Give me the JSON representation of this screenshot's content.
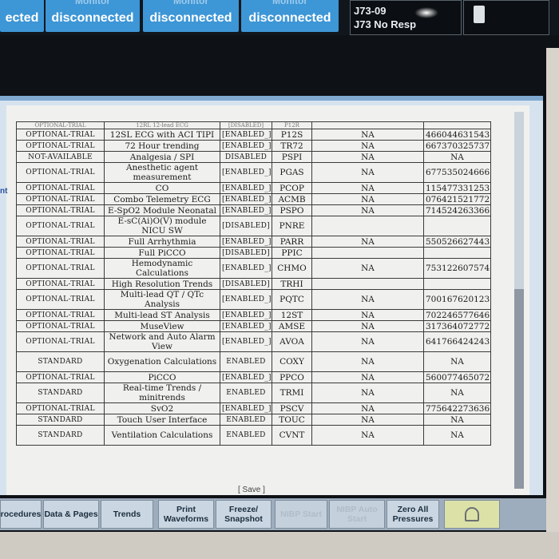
{
  "top_bar": {
    "tiles": [
      {
        "label": "ected",
        "ghost": ""
      },
      {
        "label": "disconnected",
        "ghost": "Monitor"
      },
      {
        "label": "disconnected",
        "ghost": "Monitor"
      },
      {
        "label": "disconnected",
        "ghost": "Monitor"
      }
    ],
    "alarm": {
      "line1": "J73-09",
      "line2": "J73 No Resp"
    }
  },
  "side_fragment": "nt",
  "table": {
    "partial_top": {
      "status": "OPTIONAL-TRIAL",
      "feature": "12RL 12-lead ECG",
      "enabled": "[DISABLED]",
      "code": "P12R"
    },
    "rows": [
      {
        "status": "OPTIONAL-TRIAL",
        "feature": "12SL ECG with ACI TIPI",
        "enabled": "[ENABLED_]",
        "code": "P12S",
        "na": "NA",
        "serial": "466044631543"
      },
      {
        "status": "OPTIONAL-TRIAL",
        "feature": "72 Hour trending",
        "enabled": "[ENABLED_]",
        "code": "TR72",
        "na": "NA",
        "serial": "667370325737"
      },
      {
        "status": "NOT-AVAILABLE",
        "feature": "Analgesia / SPI",
        "enabled": "DISABLED",
        "code": "PSPI",
        "na": "NA",
        "serial": "NA"
      },
      {
        "status": "OPTIONAL-TRIAL",
        "feature": "Anesthetic agent measurement",
        "enabled": "[ENABLED_]",
        "code": "PGAS",
        "na": "NA",
        "serial": "677535024666"
      },
      {
        "status": "OPTIONAL-TRIAL",
        "feature": "CO",
        "enabled": "[ENABLED_]",
        "code": "PCOP",
        "na": "NA",
        "serial": "115477331253"
      },
      {
        "status": "OPTIONAL-TRIAL",
        "feature": "Combo Telemetry ECG",
        "enabled": "[ENABLED_]",
        "code": "ACMB",
        "na": "NA",
        "serial": "076421521772"
      },
      {
        "status": "OPTIONAL-TRIAL",
        "feature": "E-SpO2 Module Neonatal",
        "enabled": "[ENABLED_]",
        "code": "PSPO",
        "na": "NA",
        "serial": "714524263366"
      },
      {
        "status": "OPTIONAL-TRIAL",
        "feature": "E-sC(Ai)O(V) module NICU SW",
        "enabled": "[DISABLED]",
        "code": "PNRE",
        "na": "",
        "serial": ""
      },
      {
        "status": "OPTIONAL-TRIAL",
        "feature": "Full Arrhythmia",
        "enabled": "[ENABLED_]",
        "code": "PARR",
        "na": "NA",
        "serial": "550526627443"
      },
      {
        "status": "OPTIONAL-TRIAL",
        "feature": "Full PiCCO",
        "enabled": "[DISABLED]",
        "code": "PPIC",
        "na": "",
        "serial": ""
      },
      {
        "status": "OPTIONAL-TRIAL",
        "feature": "Hemodynamic Calculations",
        "enabled": "[ENABLED_]",
        "code": "CHMO",
        "na": "NA",
        "serial": "753122607574"
      },
      {
        "status": "OPTIONAL-TRIAL",
        "feature": "High Resolution Trends",
        "enabled": "[DISABLED]",
        "code": "TRHI",
        "na": "",
        "serial": ""
      },
      {
        "status": "OPTIONAL-TRIAL",
        "feature": "Multi-lead QT / QTc Analysis",
        "enabled": "[ENABLED_]",
        "code": "PQTC",
        "na": "NA",
        "serial": "700167620123"
      },
      {
        "status": "OPTIONAL-TRIAL",
        "feature": "Multi-lead ST Analysis",
        "enabled": "[ENABLED_]",
        "code": "12ST",
        "na": "NA",
        "serial": "702246577646"
      },
      {
        "status": "OPTIONAL-TRIAL",
        "feature": "MuseView",
        "enabled": "[ENABLED_]",
        "code": "AMSE",
        "na": "NA",
        "serial": "317364072772"
      },
      {
        "status": "OPTIONAL-TRIAL",
        "feature": "Network and Auto Alarm View",
        "enabled": "[ENABLED_]",
        "code": "AVOA",
        "na": "NA",
        "serial": "641766424243"
      },
      {
        "status": "STANDARD",
        "feature": "Oxygenation Calculations",
        "enabled": "ENABLED",
        "code": "COXY",
        "na": "NA",
        "serial": "NA"
      },
      {
        "status": "OPTIONAL-TRIAL",
        "feature": "PiCCO",
        "enabled": "[ENABLED_]",
        "code": "PPCO",
        "na": "NA",
        "serial": "560077465072"
      },
      {
        "status": "STANDARD",
        "feature": "Real-time Trends / minitrends",
        "enabled": "ENABLED",
        "code": "TRMI",
        "na": "NA",
        "serial": "NA"
      },
      {
        "status": "OPTIONAL-TRIAL",
        "feature": "SvO2",
        "enabled": "[ENABLED_]",
        "code": "PSCV",
        "na": "NA",
        "serial": "775642273636"
      },
      {
        "status": "STANDARD",
        "feature": "Touch User Interface",
        "enabled": "ENABLED",
        "code": "TOUC",
        "na": "NA",
        "serial": "NA"
      },
      {
        "status": "STANDARD",
        "feature": "Ventilation Calculations",
        "enabled": "ENABLED",
        "code": "CVNT",
        "na": "NA",
        "serial": "NA"
      }
    ]
  },
  "save_label": "[ Save ]",
  "softkeys": [
    {
      "label": "rocedures",
      "disabled": false
    },
    {
      "label": "Data & Pages",
      "disabled": false
    },
    {
      "label": "Trends",
      "disabled": false
    },
    {
      "label": "Print Waveforms",
      "disabled": false
    },
    {
      "label": "Freeze/ Snapshot",
      "disabled": false
    },
    {
      "label": "NIBP Start",
      "disabled": true
    },
    {
      "label": "NIBP Auto Start",
      "disabled": true
    },
    {
      "label": "Zero All Pressures",
      "disabled": false
    }
  ],
  "alarm_icon": "bell-icon",
  "colors": {
    "tile_blue": "#3d96d6",
    "window_border": "#7fa9d0",
    "softkey_bg": "#cad7e3",
    "alarm_key": "#dce1a8"
  }
}
